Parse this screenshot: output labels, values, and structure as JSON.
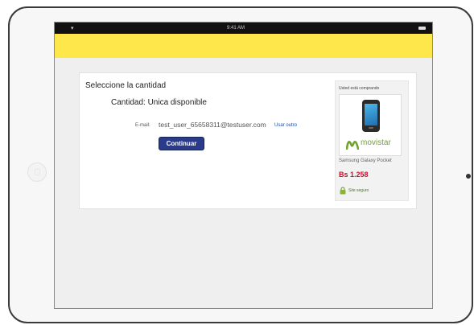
{
  "status_bar": {
    "time": "9:41 AM",
    "wifi_icon": "wifi-icon",
    "battery_icon": "battery-icon"
  },
  "colors": {
    "header_yellow": "#fde74a",
    "button_blue": "#2a3b8c",
    "price_red": "#c8102e",
    "brand_green": "#6fa32b",
    "link_blue": "#1a4db3"
  },
  "checkout": {
    "section_title": "Seleccione la cantidad",
    "quantity_text": "Cantidad: Unica disponible",
    "email_label": "E-mail:",
    "email_value": "test_user_65658311@testuser.com",
    "use_other_link": "Usar outro",
    "continue_button": "Continuar"
  },
  "sidebar": {
    "title": "Usted está comprando",
    "brand_name": "movistar",
    "product_name": "Samsung Galaxy Pocket",
    "price": "Bs 1.258",
    "secure_label": "Site seguro",
    "product_icon": "phone-icon",
    "lock_icon": "lock-icon"
  }
}
